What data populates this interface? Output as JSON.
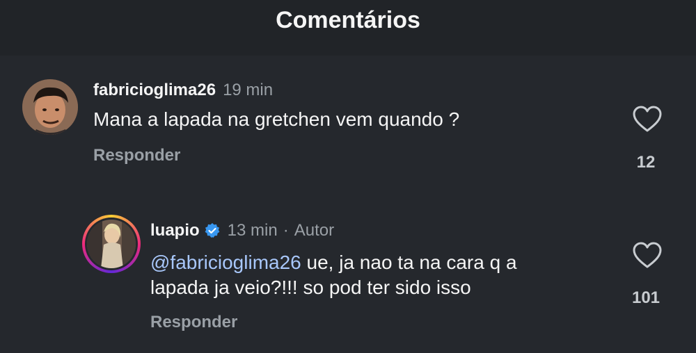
{
  "header": {
    "title": "Comentários"
  },
  "comments": [
    {
      "username": "fabricioglima26",
      "time": "19 min",
      "text": "Mana a lapada na gretchen vem quando ?",
      "reply_label": "Responder",
      "likes": "12",
      "avatar_icon": "user-avatar"
    },
    {
      "username": "luapio",
      "time": "13 min",
      "separator": "·",
      "author_label": "Autor",
      "mention": "@fabricioglima26",
      "text_line1": " ue, ja nao ta na cara q a",
      "text_line2": "lapada ja veio?!!! so pod ter sido isso",
      "reply_label": "Responder",
      "likes": "101",
      "avatar_icon": "user-avatar-story-ring",
      "verified_icon": "verified-badge-icon"
    }
  ],
  "colors": {
    "background": "#25282d",
    "header_bg": "#212428",
    "mention": "#a8c7fa",
    "muted": "#9aa0a6",
    "verified": "#3897f0"
  }
}
